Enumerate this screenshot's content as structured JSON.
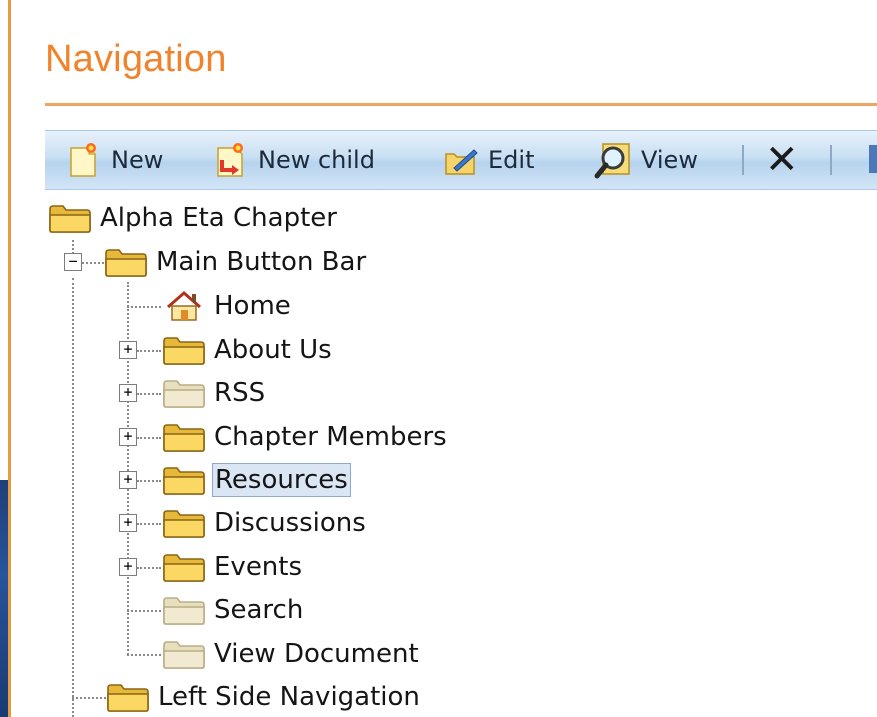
{
  "page": {
    "title": "Navigation"
  },
  "toolbar": {
    "new_label": "New",
    "new_child_label": "New child",
    "edit_label": "Edit",
    "view_label": "View"
  },
  "tree": {
    "root": {
      "label": "Alpha Eta Chapter"
    },
    "main_button_bar": {
      "label": "Main Button Bar",
      "children": [
        {
          "label": "Home"
        },
        {
          "label": "About Us"
        },
        {
          "label": "RSS"
        },
        {
          "label": "Chapter Members"
        },
        {
          "label": "Resources"
        },
        {
          "label": "Discussions"
        },
        {
          "label": "Events"
        },
        {
          "label": "Search"
        },
        {
          "label": "View Document"
        }
      ]
    },
    "left_side_navigation": {
      "label": "Left Side Navigation"
    }
  },
  "colors": {
    "title": "#f0832b",
    "selection_bg": "#dbe6f5",
    "toolbar_bg": "#c8dff3"
  },
  "icons": [
    "new-icon",
    "new-child-icon",
    "edit-icon",
    "view-icon",
    "delete-icon",
    "folder-icon",
    "home-icon"
  ]
}
